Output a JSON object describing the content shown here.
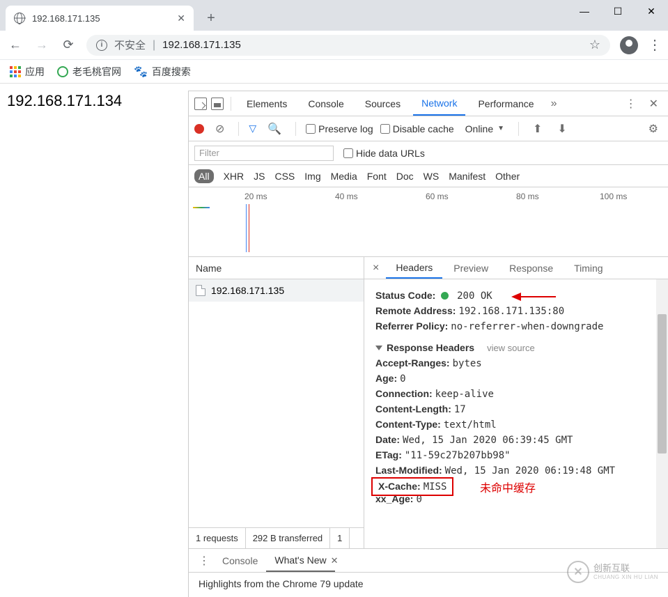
{
  "browser": {
    "tab_title": "192.168.171.135",
    "window_controls": {
      "minimize": "—",
      "maximize": "☐",
      "close": "✕"
    }
  },
  "addressbar": {
    "security_label": "不安全",
    "url": "192.168.171.135"
  },
  "bookmarks": {
    "apps": "应用",
    "lmt": "老毛桃官网",
    "baidu": "百度搜索"
  },
  "page": {
    "body_text": "192.168.171.134"
  },
  "devtools": {
    "top_tabs": [
      "Elements",
      "Console",
      "Sources",
      "Network",
      "Performance"
    ],
    "active_top": "Network",
    "more_icon": "»",
    "toolbar": {
      "preserve_log": "Preserve log",
      "disable_cache": "Disable cache",
      "throttle": "Online"
    },
    "filter": {
      "placeholder": "Filter",
      "hide_data_urls": "Hide data URLs"
    },
    "types": [
      "All",
      "XHR",
      "JS",
      "CSS",
      "Img",
      "Media",
      "Font",
      "Doc",
      "WS",
      "Manifest",
      "Other"
    ],
    "active_type": "All",
    "timeline_labels": [
      "20 ms",
      "40 ms",
      "60 ms",
      "80 ms",
      "100 ms"
    ],
    "requests": {
      "header": "Name",
      "items": [
        "192.168.171.135"
      ],
      "footer": {
        "count": "1 requests",
        "transferred": "292 B transferred",
        "extra": "1"
      }
    },
    "detail": {
      "tabs": [
        "Headers",
        "Preview",
        "Response",
        "Timing"
      ],
      "active": "Headers",
      "general": {
        "status_code_label": "Status Code:",
        "status_code_value": "200 OK",
        "remote_address_label": "Remote Address:",
        "remote_address_value": "192.168.171.135:80",
        "referrer_policy_label": "Referrer Policy:",
        "referrer_policy_value": "no-referrer-when-downgrade"
      },
      "response_headers_label": "Response Headers",
      "view_source": "view source",
      "headers": {
        "Accept-Ranges": "bytes",
        "Age": "0",
        "Connection": "keep-alive",
        "Content-Length": "17",
        "Content-Type": "text/html",
        "Date": "Wed, 15 Jan 2020 06:39:45 GMT",
        "ETag": "\"11-59c27b207bb98\"",
        "Last-Modified": "Wed, 15 Jan 2020 06:19:48 GMT",
        "X-Cache": "MISS",
        "xx_Age": "0"
      },
      "annotation": "未命中缓存"
    },
    "drawer": {
      "tabs": [
        "Console",
        "What's New"
      ],
      "active": "What's New",
      "body": "Highlights from the Chrome 79 update"
    }
  },
  "watermark": {
    "title": "创新互联",
    "sub": "CHUANG XIN HU LIAN"
  }
}
